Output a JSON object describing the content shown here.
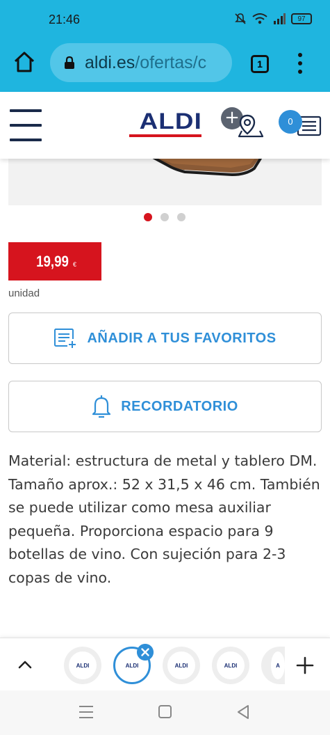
{
  "status_bar": {
    "time": "21:46",
    "battery": "97"
  },
  "browser": {
    "url_host": "aldi.es",
    "url_path": "/ofertas/c",
    "tab_count": "1"
  },
  "site_header": {
    "logo": "ALDI",
    "shopping_list_count": "0"
  },
  "carousel": {
    "slide_count": 3,
    "active_index": 0
  },
  "product": {
    "price": "19,99",
    "currency": "€",
    "unit": "unidad",
    "favorites_label": "AÑADIR A TUS FAVORITOS",
    "reminder_label": "RECORDATORIO",
    "description": "Material: estructura de metal y tablero DM. Tamaño aprox.: 52 x 31,5 x 46 cm. También se puede utilizar como mesa auxiliar pequeña. Proporciona espacio para 9 botellas de vino. Con sujeción para 2-3 copas de vino."
  },
  "tab_strip": {
    "tabs": [
      {
        "label": "ALDI"
      },
      {
        "label": "ALDI",
        "selected": true
      },
      {
        "label": "ALDI"
      },
      {
        "label": "ALDI"
      },
      {
        "label": "A"
      }
    ]
  },
  "colors": {
    "browser_bar": "#1fb5df",
    "aldi_blue": "#1b2f73",
    "aldi_red": "#d6141e",
    "accent_blue": "#2f8fd8"
  }
}
